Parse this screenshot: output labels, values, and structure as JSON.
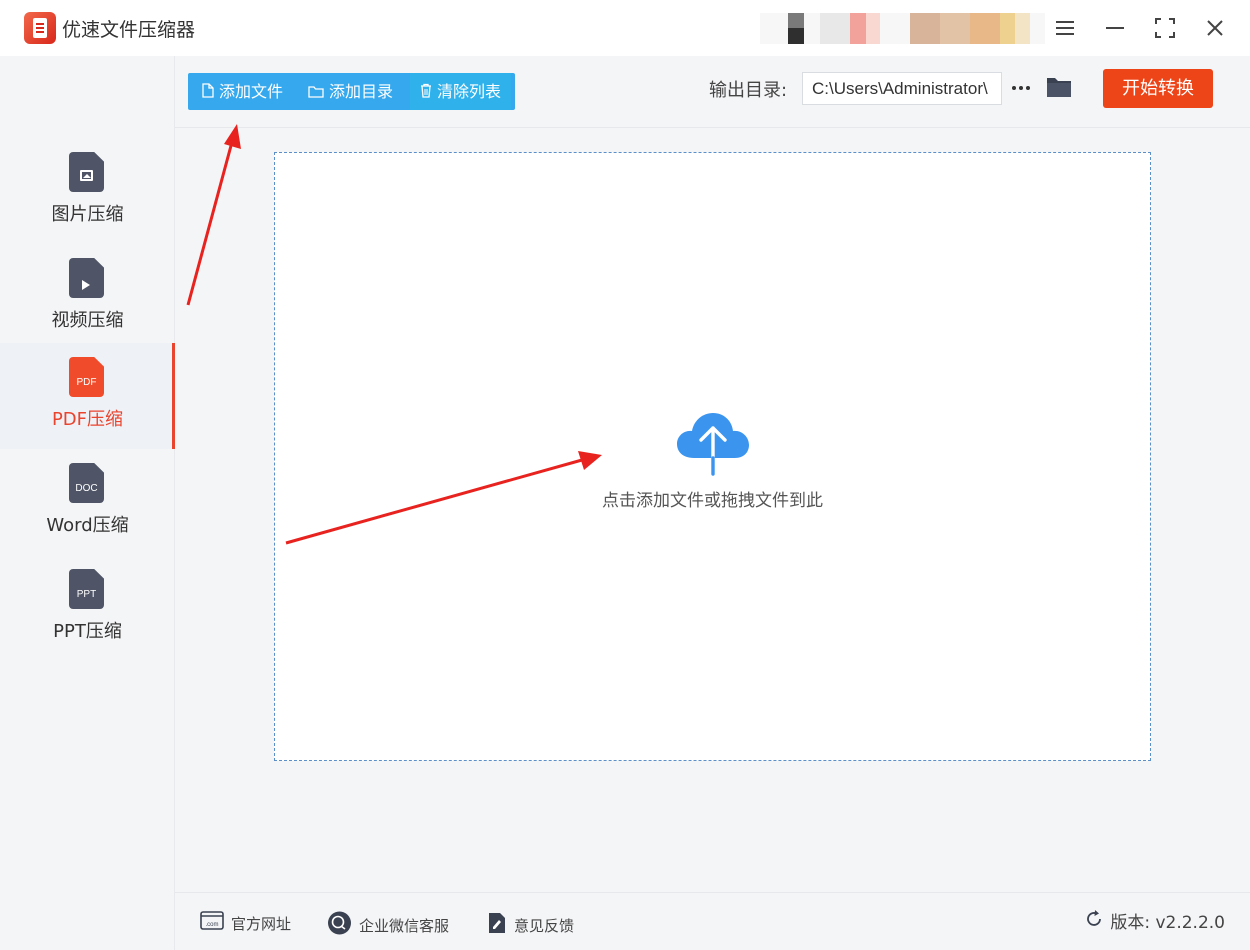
{
  "window": {
    "title": "优速文件压缩器",
    "menu_icon": "hamburger-menu-icon",
    "minimize_icon": "minimize-icon",
    "maximize_icon": "maximize-icon",
    "close_icon": "close-icon"
  },
  "sidebar": {
    "items": [
      {
        "label": "图片压缩",
        "icon": "image-file-icon",
        "active": false
      },
      {
        "label": "视频压缩",
        "icon": "video-file-icon",
        "active": false
      },
      {
        "label": "PDF压缩",
        "icon": "pdf-file-icon",
        "icon_text": "PDF",
        "active": true
      },
      {
        "label": "Word压缩",
        "icon": "doc-file-icon",
        "icon_text": "DOC",
        "active": false
      },
      {
        "label": "PPT压缩",
        "icon": "ppt-file-icon",
        "icon_text": "PPT",
        "active": false
      }
    ]
  },
  "toolbar": {
    "add_file": "添加文件",
    "add_folder": "添加目录",
    "clear_list": "清除列表",
    "output_label": "输出目录:",
    "output_path": "C:\\Users\\Administrator\\",
    "start": "开始转换"
  },
  "dropzone": {
    "text": "点击添加文件或拖拽文件到此"
  },
  "footer": {
    "website": "官方网址",
    "wechat_support": "企业微信客服",
    "feedback": "意见反馈",
    "version": "版本: v2.2.2.0"
  },
  "colors": {
    "accent_blue": "#36a9ee",
    "accent_red": "#ed4418",
    "sidebar_active": "#e9442d",
    "annotation_arrow": "#e8231f"
  }
}
